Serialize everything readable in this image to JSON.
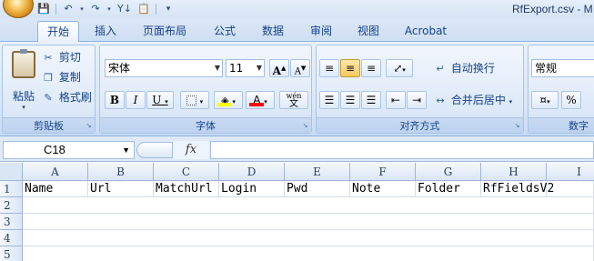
{
  "window": {
    "title": "RfExport.csv - M"
  },
  "quick_access": {
    "save_icon": "save-icon",
    "undo_icon": "undo-icon",
    "redo_icon": "redo-icon",
    "sort_icon": "sort-icon",
    "clipboard_icon": "clipboard-icon",
    "customize_icon": "customize-arrow-icon"
  },
  "tabs": [
    {
      "label": "开始",
      "active": true
    },
    {
      "label": "插入"
    },
    {
      "label": "页面布局"
    },
    {
      "label": "公式"
    },
    {
      "label": "数据"
    },
    {
      "label": "审阅"
    },
    {
      "label": "视图"
    },
    {
      "label": "Acrobat"
    }
  ],
  "ribbon": {
    "clipboard": {
      "group_label": "剪贴板",
      "paste_label": "粘贴",
      "cut_label": "剪切",
      "copy_label": "复制",
      "format_painter_label": "格式刷"
    },
    "font": {
      "group_label": "字体",
      "font_name": "宋体",
      "font_size": "11",
      "bold": "B",
      "italic": "I",
      "underline": "U",
      "grow_font": "A",
      "shrink_font": "A",
      "font_color_letter": "A",
      "phonetic_label": "wén",
      "phonetic_char": "文",
      "fill_color": "#ffff00",
      "font_color": "#ff0000"
    },
    "alignment": {
      "group_label": "对齐方式",
      "wrap_text_label": "自动换行",
      "merge_center_label": "合并后居中"
    },
    "number": {
      "group_label": "数字",
      "format": "常规",
      "percent": "%"
    }
  },
  "formula_bar": {
    "name_box": "C18",
    "fx_label": "fx",
    "formula": ""
  },
  "sheet": {
    "columns": [
      "A",
      "B",
      "C",
      "D",
      "E",
      "F",
      "G",
      "H",
      "I"
    ],
    "rows": [
      "1",
      "2",
      "3",
      "4",
      "5"
    ],
    "row1": [
      "Name",
      "Url",
      "MatchUrl",
      "Login",
      "Pwd",
      "Note",
      "Folder",
      "RfFieldsV2",
      ""
    ]
  }
}
